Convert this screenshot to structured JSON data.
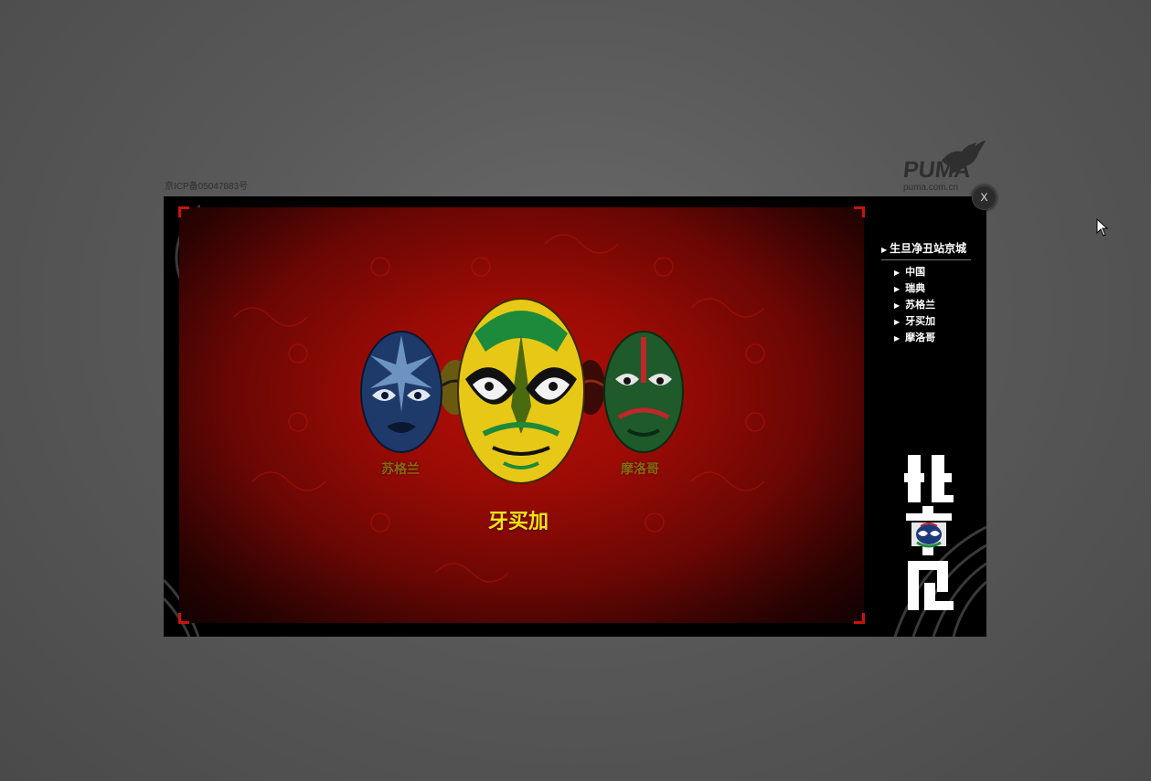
{
  "page": {
    "icp_text": "京ICP备05047883号",
    "close_label": "X"
  },
  "brand": {
    "name": "PUMA",
    "url": "puma.com.cn"
  },
  "menu": {
    "heading": "生旦净丑站京城",
    "items": [
      {
        "label": "中国"
      },
      {
        "label": "瑞典"
      },
      {
        "label": "苏格兰"
      },
      {
        "label": "牙买加"
      },
      {
        "label": "摩洛哥"
      }
    ]
  },
  "carousel": {
    "selected": "牙买加",
    "left_label": "苏格兰",
    "right_label": "摩洛哥"
  },
  "side_art": {
    "text": "北京见"
  },
  "colors": {
    "background": "#595959",
    "stage_red": "#b50e07",
    "title_yellow": "#f4e21a",
    "label_olive": "#8a6a10"
  }
}
